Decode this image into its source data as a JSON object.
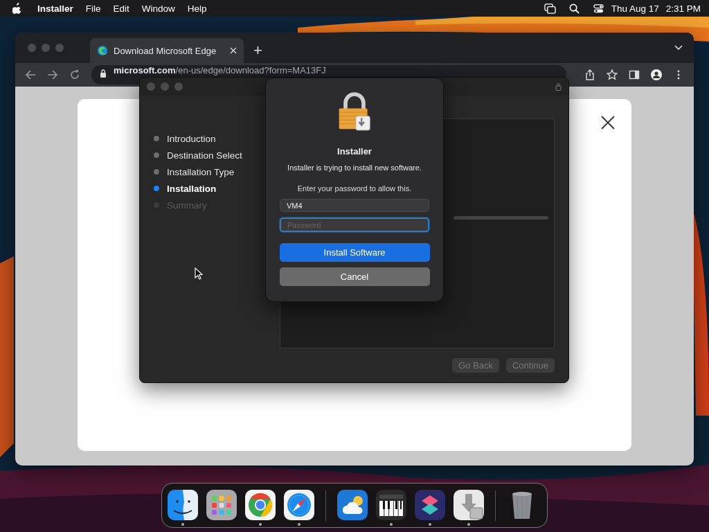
{
  "menubar": {
    "app": "Installer",
    "menus": [
      "File",
      "Edit",
      "Window",
      "Help"
    ],
    "date": "Thu Aug 17",
    "time": "2:31 PM"
  },
  "browser": {
    "tabs": [
      {
        "title": "Download Microsoft Edge",
        "selected": true
      }
    ],
    "new_tab": "+",
    "url": {
      "domain": "microsoft.com",
      "path": "/en-us/edge/download?form=MA13FJ"
    }
  },
  "installer": {
    "steps": [
      {
        "label": "Introduction",
        "completed": true,
        "selected": false
      },
      {
        "label": "Destination Select",
        "completed": true,
        "selected": false
      },
      {
        "label": "Installation Type",
        "completed": true,
        "selected": false
      },
      {
        "label": "Installation",
        "completed": true,
        "selected": true
      },
      {
        "label": "Summary",
        "completed": false,
        "selected": false
      }
    ],
    "progress": {
      "level": 0
    },
    "buttons": [
      {
        "label": "Go Back",
        "disabled": true
      },
      {
        "label": "Continue",
        "disabled": true
      }
    ]
  },
  "dialog": {
    "title": "Installer",
    "message": "Installer is trying to install new software.",
    "prompt": "Enter your password to allow this.",
    "username": "VM4",
    "password": {
      "placeholder": "Password",
      "focused": true
    },
    "primary": "Install Software",
    "cancel": "Cancel"
  },
  "dock": [
    {
      "kind": "finder",
      "running": true
    },
    {
      "kind": "launchpad",
      "running": false
    },
    {
      "kind": "chrome",
      "running": true
    },
    {
      "kind": "safari",
      "running": true
    },
    {
      "kind": "separator"
    },
    {
      "kind": "weather",
      "running": false
    },
    {
      "kind": "piano",
      "running": true
    },
    {
      "kind": "shortcuts",
      "running": true
    },
    {
      "kind": "installer",
      "running": true
    },
    {
      "kind": "separator"
    },
    {
      "kind": "trash",
      "running": false
    }
  ]
}
